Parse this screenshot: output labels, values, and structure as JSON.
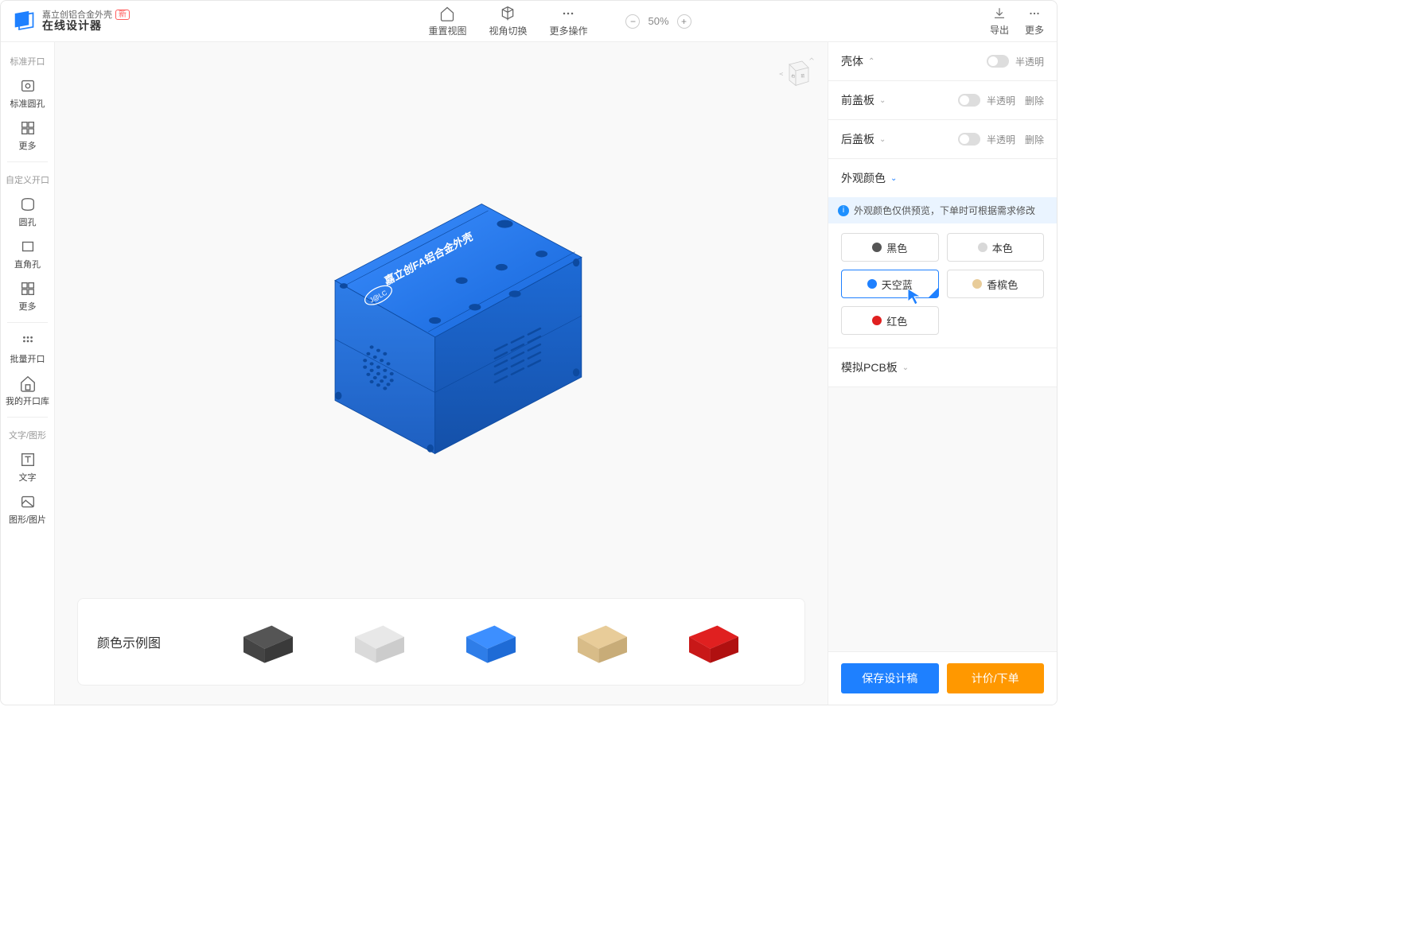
{
  "header": {
    "logo_title": "嘉立创铝合金外壳",
    "logo_sub": "在线设计器",
    "badge": "新",
    "center": [
      {
        "label": "重置视图"
      },
      {
        "label": "视角切换"
      },
      {
        "label": "更多操作"
      }
    ],
    "zoom": "50%",
    "right": [
      {
        "label": "导出"
      },
      {
        "label": "更多"
      }
    ]
  },
  "sidebar": {
    "sections": [
      {
        "title": "标准开口",
        "items": [
          {
            "label": "标准圆孔"
          },
          {
            "label": "更多"
          }
        ]
      },
      {
        "title": "自定义开口",
        "items": [
          {
            "label": "圆孔"
          },
          {
            "label": "直角孔"
          },
          {
            "label": "更多"
          }
        ]
      },
      {
        "title": "",
        "items": [
          {
            "label": "批量开口"
          },
          {
            "label": "我的开口库"
          }
        ]
      },
      {
        "title": "文字/图形",
        "items": [
          {
            "label": "文字"
          },
          {
            "label": "图形/图片"
          }
        ]
      }
    ]
  },
  "canvas": {
    "box_text": "嘉立创FA铝合金外壳",
    "thumb_title": "颜色示例图"
  },
  "right_panel": {
    "sections": [
      {
        "title": "壳体",
        "translucent": "半透明",
        "delete": null
      },
      {
        "title": "前盖板",
        "translucent": "半透明",
        "delete": "删除"
      },
      {
        "title": "后盖板",
        "translucent": "半透明",
        "delete": "删除"
      }
    ],
    "color_section": {
      "title": "外观颜色",
      "info": "外观颜色仅供预览，下单时可根据需求修改",
      "options": [
        {
          "label": "黑色",
          "color": "#555555",
          "selected": false
        },
        {
          "label": "本色",
          "color": "#d8d8d8",
          "selected": false
        },
        {
          "label": "天空蓝",
          "color": "#1e80ff",
          "selected": true
        },
        {
          "label": "香槟色",
          "color": "#e8cc99",
          "selected": false
        },
        {
          "label": "红色",
          "color": "#e02020",
          "selected": false
        }
      ]
    },
    "pcb_section": {
      "title": "模拟PCB板"
    },
    "footer": {
      "save": "保存设计稿",
      "order": "计价/下单"
    }
  }
}
